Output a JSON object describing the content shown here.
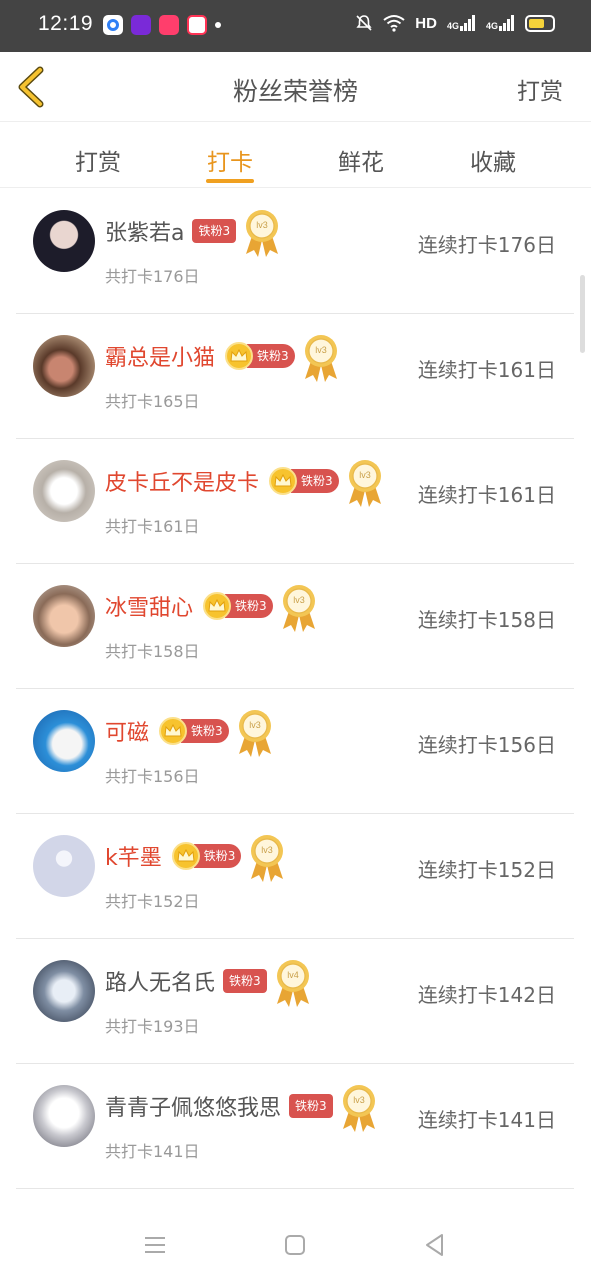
{
  "status_bar": {
    "time": "12:19",
    "network": "HD",
    "signal1": "4G",
    "signal2": "4G"
  },
  "header": {
    "title": "粉丝荣誉榜",
    "action": "打赏"
  },
  "tabs": [
    {
      "label": "打赏",
      "active": false
    },
    {
      "label": "打卡",
      "active": true
    },
    {
      "label": "鲜花",
      "active": false
    },
    {
      "label": "收藏",
      "active": false
    }
  ],
  "rows": [
    {
      "name": "张紫若a",
      "vip": false,
      "fan_badge": "铁粉3",
      "level": "lv3",
      "total": "共打卡176日",
      "streak": "连续打卡176日"
    },
    {
      "name": "霸总是小猫",
      "vip": true,
      "fan_badge": "铁粉3",
      "level": "lv3",
      "total": "共打卡165日",
      "streak": "连续打卡161日"
    },
    {
      "name": "皮卡丘不是皮卡",
      "vip": true,
      "fan_badge": "铁粉3",
      "level": "lv3",
      "total": "共打卡161日",
      "streak": "连续打卡161日"
    },
    {
      "name": "冰雪甜心",
      "vip": true,
      "fan_badge": "铁粉3",
      "level": "lv3",
      "total": "共打卡158日",
      "streak": "连续打卡158日"
    },
    {
      "name": "可磁",
      "vip": true,
      "fan_badge": "铁粉3",
      "level": "lv3",
      "total": "共打卡156日",
      "streak": "连续打卡156日"
    },
    {
      "name": "k芊墨",
      "vip": true,
      "fan_badge": "铁粉3",
      "level": "lv3",
      "total": "共打卡152日",
      "streak": "连续打卡152日"
    },
    {
      "name": "路人无名氏",
      "vip": false,
      "fan_badge": "铁粉3",
      "level": "lv4",
      "total": "共打卡193日",
      "streak": "连续打卡142日"
    },
    {
      "name": "青青子佩悠悠我思",
      "vip": false,
      "fan_badge": "铁粉3",
      "level": "lv3",
      "total": "共打卡141日",
      "streak": "连续打卡141日"
    }
  ],
  "colors": {
    "accent": "#f0a020",
    "vip_name": "#e0472f",
    "fan_badge": "#d8534f",
    "crown": "#f7c32e"
  }
}
